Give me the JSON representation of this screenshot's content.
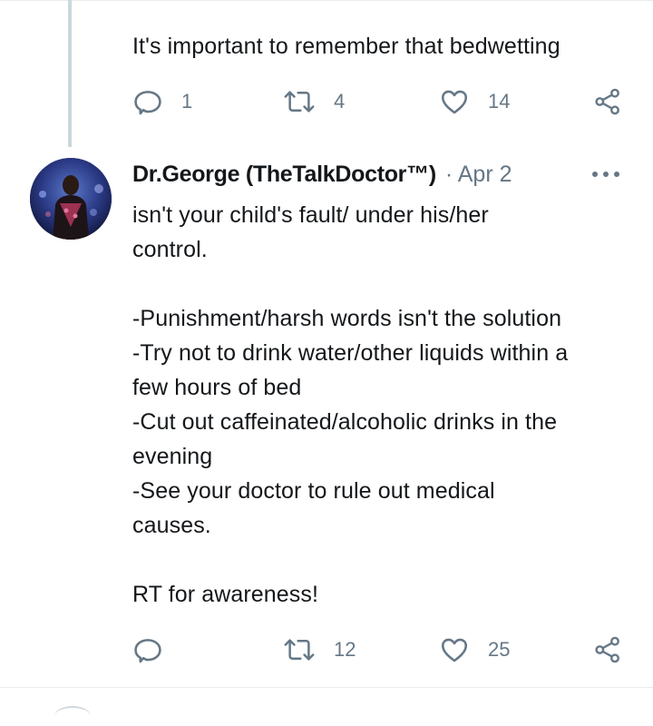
{
  "previous_tweet": {
    "text": "It's important to remember that bedwetting",
    "replies": "1",
    "retweets": "4",
    "likes": "14"
  },
  "tweet": {
    "author": "Dr.George (TheTalkDoctor™)",
    "meta": "· Apr 2",
    "text": "isn't your child's fault/ under his/her\ncontrol.\n\n-Punishment/harsh words isn't the solution\n-Try not to drink water/other liquids within a\nfew hours of bed\n-Cut out caffeinated/alcoholic drinks in the\nevening\n-See your doctor to rule out medical\ncauses.\n\nRT for awareness!",
    "replies": "",
    "retweets": "12",
    "likes": "25"
  },
  "icons": {
    "reply": "reply-icon",
    "retweet": "retweet-icon",
    "like": "heart-icon",
    "share": "share-icon",
    "more": "more-options-icon"
  },
  "colors": {
    "text": "#14171a",
    "secondary": "#657786",
    "thread_line": "#ccd6dd",
    "divider": "#e6ecf0"
  }
}
